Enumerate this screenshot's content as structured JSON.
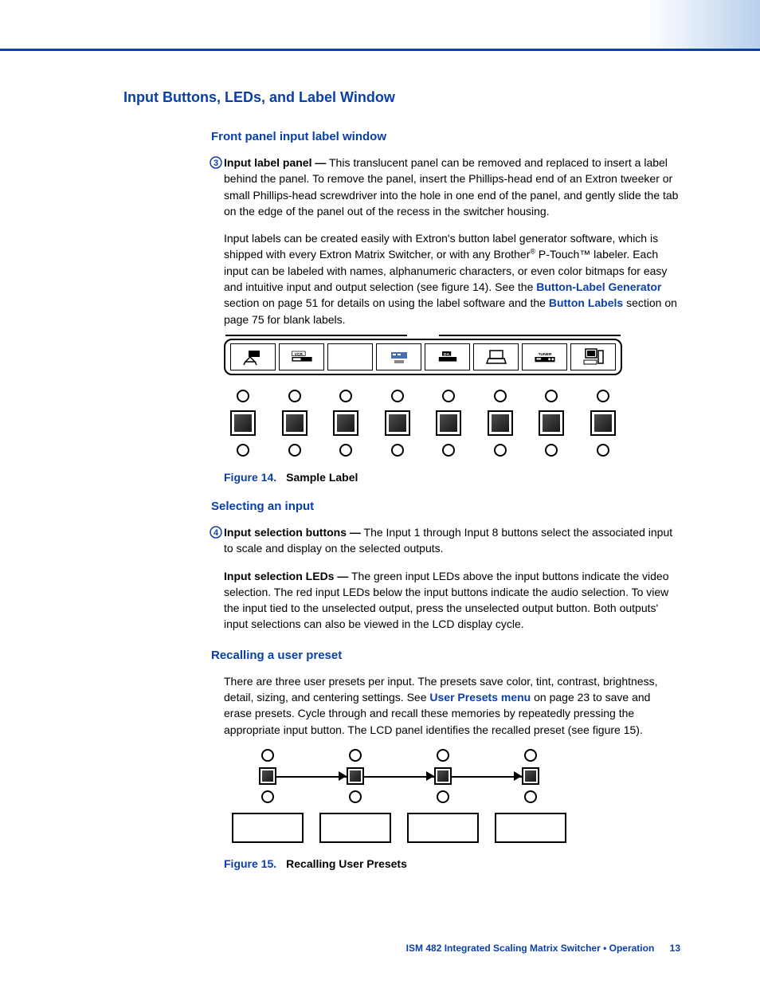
{
  "heading_main": "Input Buttons, LEDs, and Label Window",
  "section1": {
    "heading": "Front panel input label window",
    "callout_num": "3",
    "callout_label": "Input label panel —",
    "para1_after_label": " This translucent panel can be removed and replaced to insert a label behind the panel.  To remove the panel, insert the Phillips-head end of an Extron tweeker or small Phillips-head screwdriver into the hole in one end of the panel, and gently slide the tab on the edge of the panel out of the recess in the switcher housing.",
    "para2a": "Input labels can be created easily with Extron's button label generator software, which is shipped with every Extron Matrix Switcher, or with any Brother",
    "reg": "®",
    "para2b": " P-Touch™ labeler.  Each input can be labeled with names, alphanumeric characters, or even color bitmaps for easy and intuitive input and output selection (see figure 14).  See the ",
    "link1": "Button-Label Generator",
    "para2c": " section on page 51 for details on using the label software and the ",
    "link2": "Button Labels",
    "para2d": " section on page 75 for blank labels."
  },
  "figure14": {
    "labels": [
      "camera-icon",
      "VCR",
      "blank",
      "modem-icon",
      "DA",
      "laptop-icon",
      "TUNER",
      "pc-icon"
    ],
    "num": "Figure 14.",
    "title": "Sample Label"
  },
  "section2": {
    "heading": "Selecting an input",
    "callout_num": "4",
    "callout_label": "Input selection buttons —",
    "para1_after_label": " The Input 1 through Input 8 buttons select the associated input to scale and display on the selected outputs.",
    "para2_label": "Input selection LEDs —",
    "para2_text": " The green input LEDs above the input buttons indicate the video selection.  The red input LEDs below the input buttons indicate the audio selection.  To view the input tied to the unselected output, press the unselected output button.  Both outputs' input selections can also be viewed in the LCD display cycle."
  },
  "section3": {
    "heading": "Recalling a user preset",
    "para1a": "There are three user presets per input.  The presets save color, tint, contrast, brightness, detail, sizing, and centering settings.  See ",
    "link1": "User Presets menu",
    "para1b": " on page 23 to save and erase presets.  Cycle through and recall these memories by repeatedly pressing the appropriate input button.  The LCD panel identifies the recalled preset (see figure 15)."
  },
  "figure15": {
    "num": "Figure 15.",
    "title": "Recalling User Presets"
  },
  "footer": {
    "text": "ISM 482 Integrated Scaling Matrix Switcher • Operation",
    "page": "13"
  }
}
